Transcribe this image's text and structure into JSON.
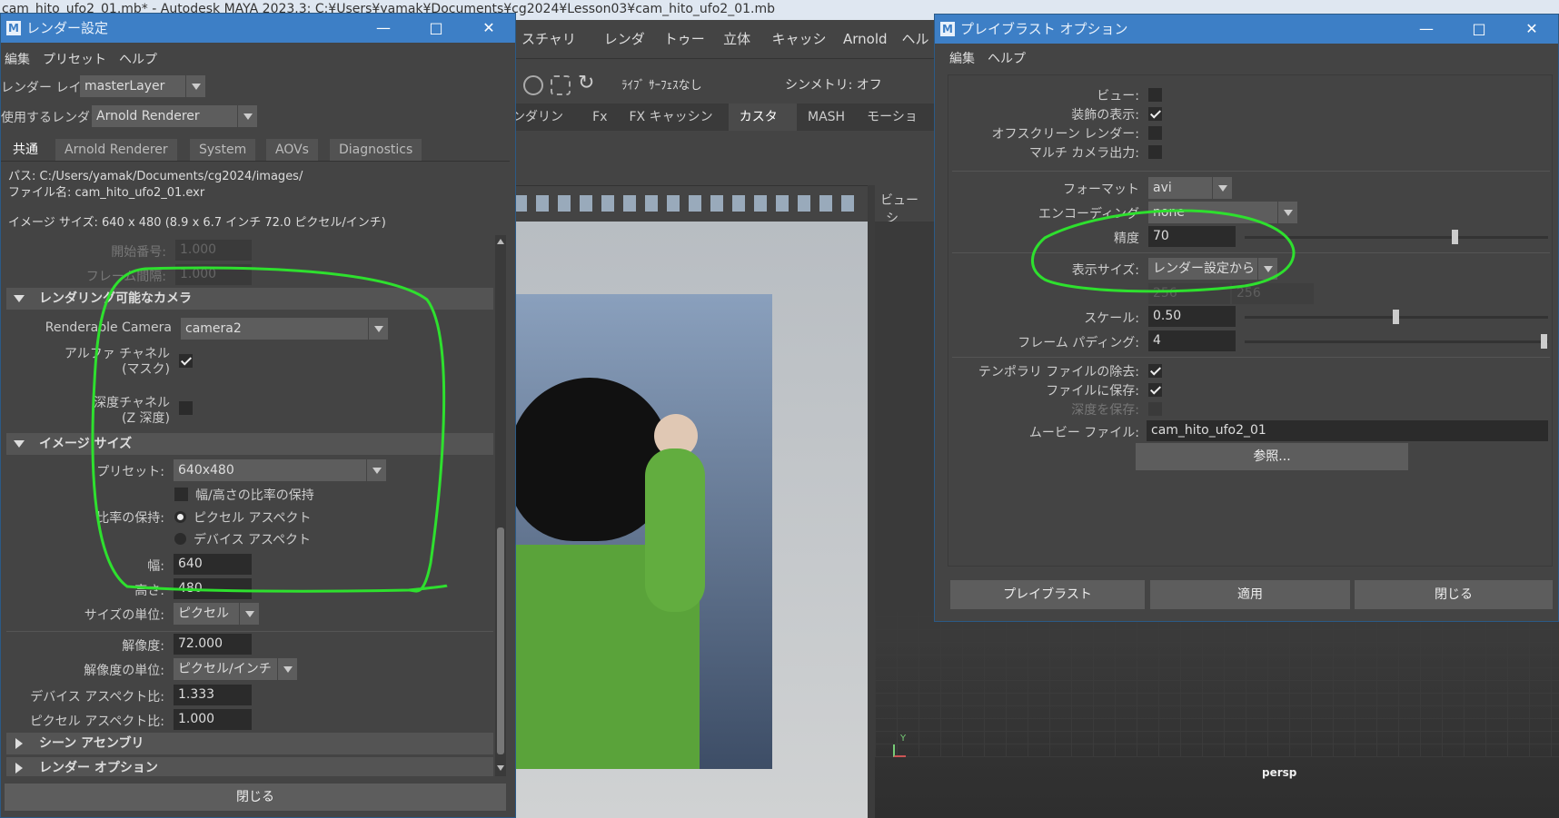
{
  "window_title": "cam_hito_ufo2_01.mb* - Autodesk MAYA 2023.3: C:¥Users¥yamak¥Documents¥cg2024¥Lesson03¥cam_hito_ufo2_01.mb",
  "render_settings": {
    "title": "レンダー設定",
    "menu": [
      "編集",
      "プリセット",
      "ヘルプ"
    ],
    "render_layer_label": "レンダー レイヤ",
    "render_layer_value": "masterLayer",
    "renderer_label": "使用するレンダラ",
    "renderer_value": "Arnold Renderer",
    "tabs": [
      "共通",
      "Arnold Renderer",
      "System",
      "AOVs",
      "Diagnostics"
    ],
    "path_line": "パス: C:/Users/yamak/Documents/cg2024/images/",
    "filename_line": "ファイル名: cam_hito_ufo2_01.exr",
    "image_size_line": "イメージ サイズ: 640 x 480 (8.9 x 6.7 インチ 72.0 ピクセル/インチ)",
    "start_frame_label": "開始番号:",
    "start_frame_value": "1.000",
    "frame_step_label": "フレーム間隔:",
    "frame_step_value": "1.000",
    "cam_section": "レンダリング可能なカメラ",
    "renderable_camera_label": "Renderable Camera",
    "renderable_camera_value": "camera2",
    "alpha_label": "アルファ チャネル",
    "alpha_sub": "(マスク)",
    "depth_label": "深度チャネル",
    "depth_sub": "(Z 深度)",
    "imgsize_section": "イメージ サイズ",
    "preset_label": "プリセット:",
    "preset_value": "640x480",
    "keep_ratio_label": "幅/高さの比率の保持",
    "ratio_label": "比率の保持:",
    "pixel_aspect_opt": "ピクセル アスペクト",
    "device_aspect_opt": "デバイス アスペクト",
    "width_label": "幅:",
    "width_value": "640",
    "height_label": "高さ:",
    "height_value": "480",
    "size_unit_label": "サイズの単位:",
    "size_unit_value": "ピクセル",
    "resolution_label": "解像度:",
    "resolution_value": "72.000",
    "res_unit_label": "解像度の単位:",
    "res_unit_value": "ピクセル/インチ",
    "device_aspect_label": "デバイス アスペクト比:",
    "device_aspect_value": "1.333",
    "pixel_aspect_label": "ピクセル アスペクト比:",
    "pixel_aspect_value": "1.000",
    "scene_assembly_section": "シーン アセンブリ",
    "render_options_section": "レンダー オプション",
    "close_button": "閉じる"
  },
  "maya_main": {
    "menu": [
      "スチャリング",
      "レンダー",
      "トゥーン",
      "立体視",
      "キャッシュ",
      "Arnold",
      "ヘルプ"
    ],
    "live_surface": "ﾗｲﾌﾞ ｻｰﾌｪｽなし",
    "symmetry": "シンメトリ: オフ",
    "shelf_tabs": [
      "ンダリング",
      "Fx",
      "FX キャッシング",
      "カスタム",
      "MASH",
      "モーション"
    ],
    "panel_menu": [
      "ビュー",
      "シ"
    ],
    "persp_label": "persp",
    "axis_y": "Y"
  },
  "playblast": {
    "title": "プレイブラスト オプション",
    "menu": [
      "編集",
      "ヘルプ"
    ],
    "view_label": "ビュー:",
    "ornaments_label": "装飾の表示:",
    "offscreen_label": "オフスクリーン レンダー:",
    "multicam_label": "マルチ カメラ出力:",
    "format_label": "フォーマット",
    "format_value": "avi",
    "encoding_label": "エンコーディング",
    "encoding_value": "none",
    "quality_label": "精度",
    "quality_value": "70",
    "quality_level": 70,
    "display_size_label": "表示サイズ:",
    "display_size_value": "レンダー設定から",
    "w_dim": "256",
    "h_dim": "256",
    "scale_label": "スケール:",
    "scale_value": "0.50",
    "scale_level": 0.5,
    "padding_label": "フレーム パディング:",
    "padding_value": "4",
    "padding_level": 1.0,
    "remove_temp_label": "テンポラリ ファイルの除去:",
    "save_file_label": "ファイルに保存:",
    "save_depth_label": "深度を保存:",
    "movie_file_label": "ムービー ファイル:",
    "movie_file_value": "cam_hito_ufo2_01",
    "browse_button": "参照...",
    "playblast_button": "プレイブラスト",
    "apply_button": "適用",
    "close_button": "閉じる"
  }
}
